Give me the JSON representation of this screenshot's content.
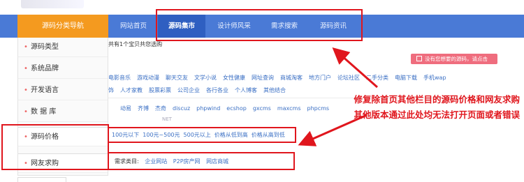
{
  "nav": {
    "category_label": "源码分类导航",
    "items": [
      {
        "label": "网站首页",
        "active": false
      },
      {
        "label": "源码集市",
        "active": true
      },
      {
        "label": "设计师风采",
        "active": false
      },
      {
        "label": "需求搜索",
        "active": false
      },
      {
        "label": "源码资讯",
        "active": false
      }
    ]
  },
  "sidebar": {
    "items": [
      {
        "label": "源码类型"
      },
      {
        "label": "系统品牌"
      },
      {
        "label": "开发语言"
      },
      {
        "label": "数 据 库"
      },
      {
        "label": "源码价格"
      },
      {
        "label": "网友求购"
      }
    ]
  },
  "content": {
    "notice": "共有1个宝贝共您选购",
    "hint_button": "没有您想要的源码，请点击",
    "type_row1": [
      "电影音乐",
      "游戏动漫",
      "聊天交友",
      "文学小说",
      "女性健康",
      "网址查询",
      "商城淘客",
      "地方门户",
      "论坛社区",
      "二手分类",
      "电脑下载",
      "手机wap"
    ],
    "type_row2": [
      "饰",
      "人才家教",
      "股票彩票",
      "公司企业",
      "各行各业",
      "个人博客",
      "其他结合"
    ],
    "brand_row": [
      "动易",
      "齐博",
      "杰奇",
      "discuz",
      "phpwind",
      "ecshop",
      "gxcms",
      "maxcms",
      "phpcms"
    ],
    "lang_row": [
      "NET"
    ],
    "price_row": [
      "100元以下",
      "100元~500元",
      "500元以上",
      "价格从低到高",
      "价格从高到低"
    ],
    "demand_label": "需求类目:",
    "demand_links": [
      "企业网站",
      "P2P房产网",
      "网店商城"
    ]
  },
  "annotation": {
    "line1": "修复除首页其他栏目的源码价格和网友求购",
    "line2": "其他版本通过此处均无法打开页面或者错误"
  },
  "colors": {
    "nav_bg": "#4a7ad6",
    "nav_active": "#2f5fc1",
    "category_head": "#f49a1f",
    "highlight_red": "#e0161d",
    "hint_pink": "#ef6d7e",
    "link_blue": "#3a6fc4"
  },
  "icons": {
    "hint": "mail-icon",
    "bullet": "bullet-dot"
  }
}
